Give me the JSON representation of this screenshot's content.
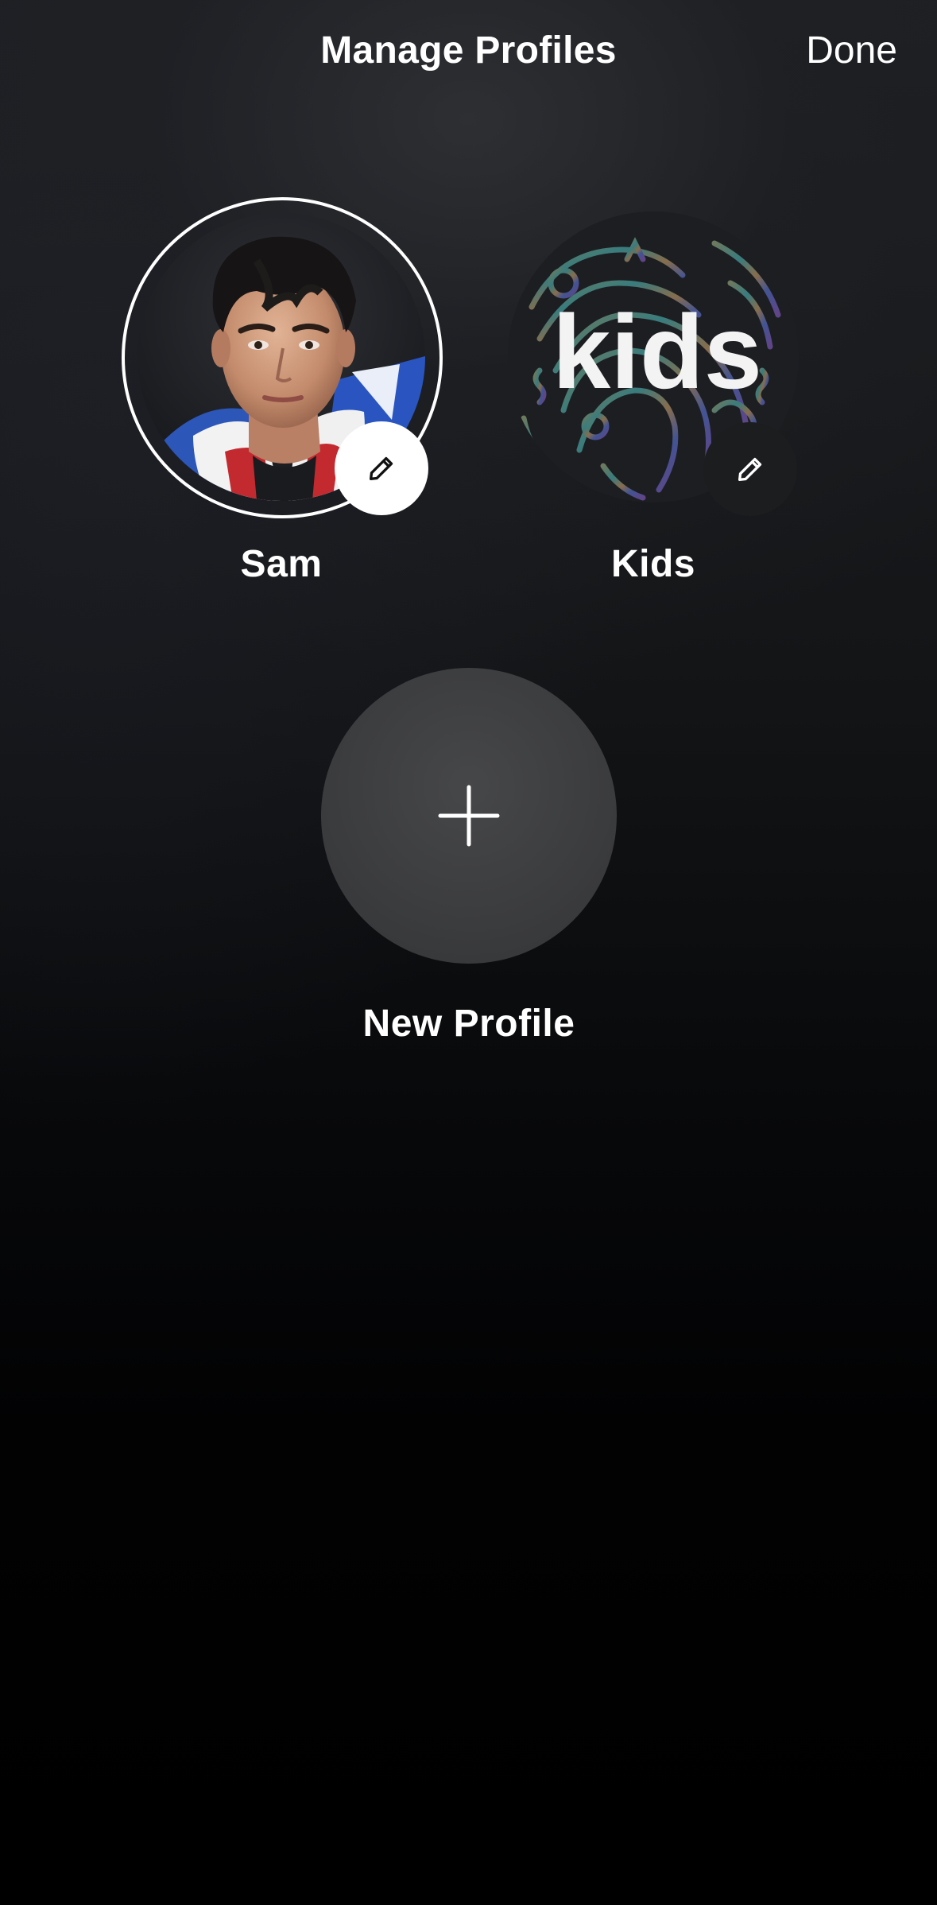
{
  "header": {
    "title": "Manage Profiles",
    "done_label": "Done"
  },
  "profiles": [
    {
      "name": "Sam",
      "avatar": "person-photo",
      "edit_icon": "pencil-icon"
    },
    {
      "name": "Kids",
      "avatar": "kids-logo",
      "avatar_text": "kids",
      "edit_icon": "pencil-icon"
    }
  ],
  "new_profile": {
    "label": "New Profile",
    "icon": "plus-icon"
  },
  "colors": {
    "background_top": "#1d1f23",
    "background_bottom": "#000000",
    "text": "#ffffff",
    "new_profile_circle": "#3f4042",
    "edit_badge_light": "#ffffff",
    "edit_badge_dark": "#1c1d1f"
  }
}
